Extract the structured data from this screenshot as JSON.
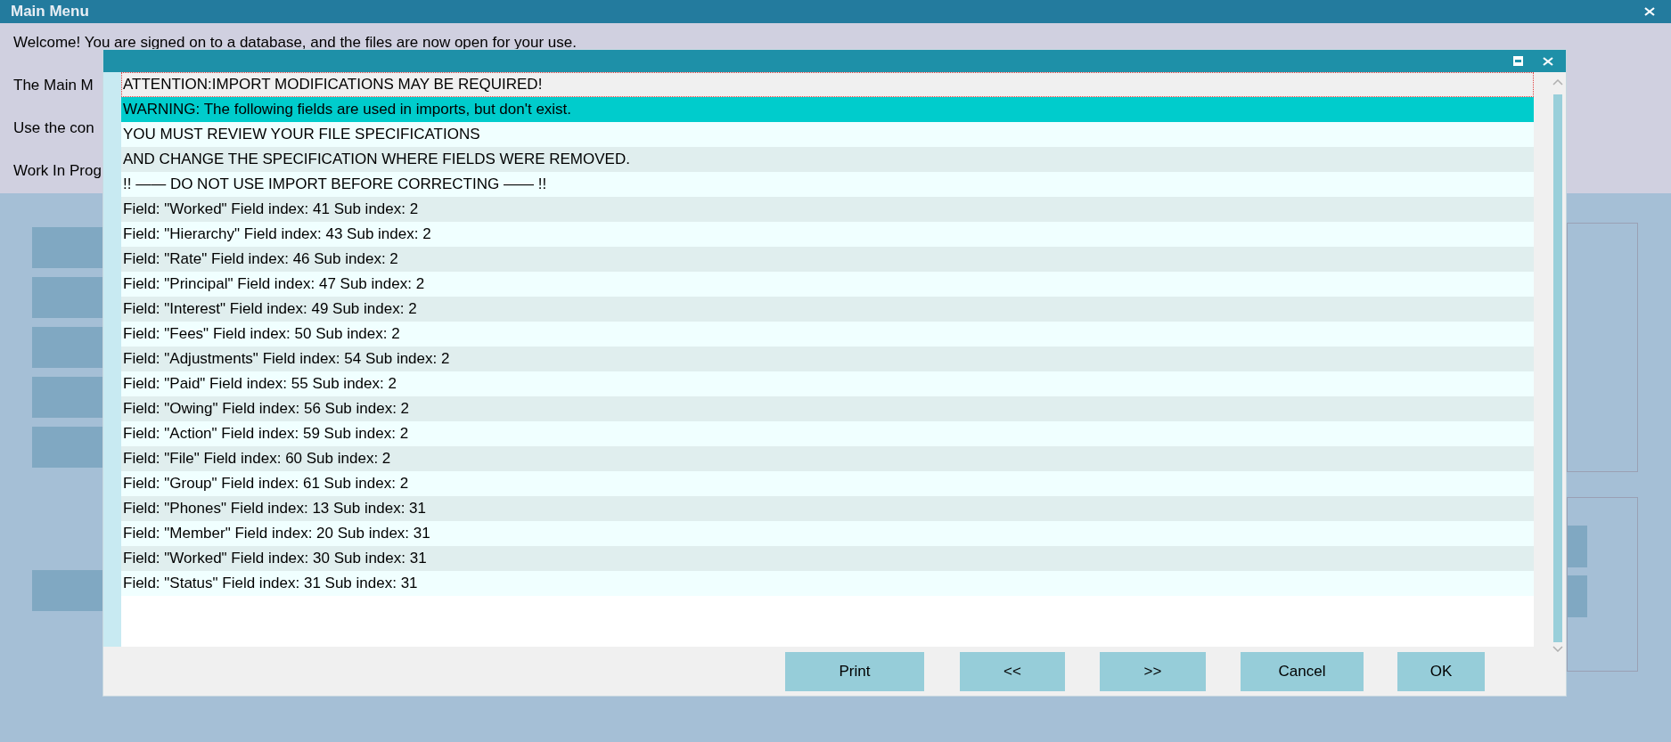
{
  "window": {
    "title": "Main Menu"
  },
  "intro_lines": [
    "Welcome! You are signed on to a database, and the files are now open for your use.",
    "The Main M",
    "Use the con",
    "Work In Prog"
  ],
  "dialog": {
    "rows": [
      {
        "text": "ATTENTION:IMPORT MODIFICATIONS MAY BE REQUIRED!",
        "selected": false,
        "focused": true
      },
      {
        "text": "WARNING: The following fields are used in imports, but don't exist.",
        "selected": true,
        "focused": false
      },
      {
        "text": "YOU MUST REVIEW YOUR FILE SPECIFICATIONS",
        "selected": false,
        "focused": false
      },
      {
        "text": "AND CHANGE THE SPECIFICATION WHERE FIELDS WERE REMOVED.",
        "selected": false,
        "focused": false
      },
      {
        "text": "!! —— DO NOT USE IMPORT BEFORE CORRECTING —— !!",
        "selected": false,
        "focused": false
      },
      {
        "text": "Field: \"Worked\" Field index: 41 Sub index: 2",
        "selected": false,
        "focused": false
      },
      {
        "text": "Field: \"Hierarchy\" Field index: 43 Sub index: 2",
        "selected": false,
        "focused": false
      },
      {
        "text": "Field: \"Rate\" Field index: 46 Sub index: 2",
        "selected": false,
        "focused": false
      },
      {
        "text": "Field: \"Principal\" Field index: 47 Sub index: 2",
        "selected": false,
        "focused": false
      },
      {
        "text": "Field: \"Interest\" Field index: 49 Sub index: 2",
        "selected": false,
        "focused": false
      },
      {
        "text": "Field: \"Fees\" Field index: 50 Sub index: 2",
        "selected": false,
        "focused": false
      },
      {
        "text": "Field: \"Adjustments\" Field index: 54 Sub index: 2",
        "selected": false,
        "focused": false
      },
      {
        "text": "Field: \"Paid\" Field index: 55 Sub index: 2",
        "selected": false,
        "focused": false
      },
      {
        "text": "Field: \"Owing\" Field index: 56 Sub index: 2",
        "selected": false,
        "focused": false
      },
      {
        "text": "Field: \"Action\" Field index: 59 Sub index: 2",
        "selected": false,
        "focused": false
      },
      {
        "text": "Field: \"File\" Field index: 60 Sub index: 2",
        "selected": false,
        "focused": false
      },
      {
        "text": "Field: \"Group\" Field index: 61 Sub index: 2",
        "selected": false,
        "focused": false
      },
      {
        "text": "Field: \"Phones\" Field index: 13 Sub index: 31",
        "selected": false,
        "focused": false
      },
      {
        "text": "Field: \"Member\" Field index: 20 Sub index: 31",
        "selected": false,
        "focused": false
      },
      {
        "text": "Field: \"Worked\" Field index: 30 Sub index: 31",
        "selected": false,
        "focused": false
      },
      {
        "text": "Field: \"Status\" Field index: 31 Sub index: 31",
        "selected": false,
        "focused": false
      }
    ],
    "buttons": [
      "Print",
      "<<",
      ">>",
      "Cancel",
      "OK"
    ]
  }
}
